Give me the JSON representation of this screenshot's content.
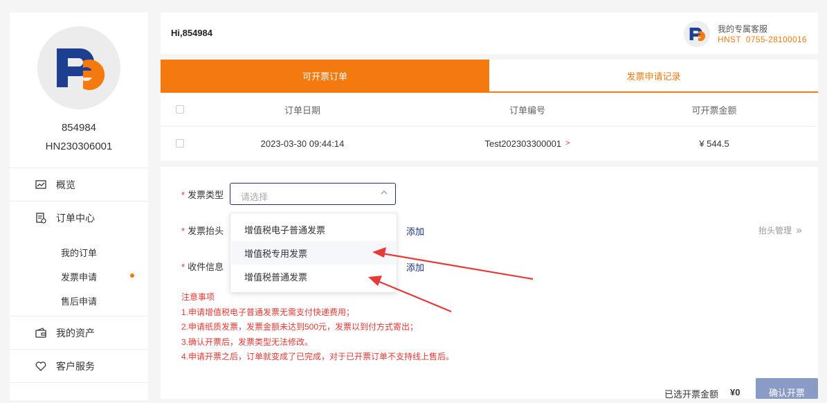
{
  "user": {
    "name": "854984",
    "id": "HN230306001"
  },
  "nav": {
    "items": [
      {
        "label": "概览",
        "icon": "chart-icon"
      },
      {
        "label": "订单中心",
        "icon": "document-icon"
      },
      {
        "label": "我的资产",
        "icon": "wallet-icon"
      },
      {
        "label": "客户服务",
        "icon": "heart-icon"
      }
    ],
    "sub_items": [
      "我的订单",
      "发票申请",
      "售后申请"
    ]
  },
  "header": {
    "greeting": "Hi,854984",
    "service_title": "我的专属客服",
    "service_phone": "HNST  0755-28100016"
  },
  "tabs": [
    "可开票订单",
    "发票申请记录"
  ],
  "table": {
    "headers": [
      "订单日期",
      "订单编号",
      "可开票金额"
    ],
    "rows": [
      {
        "date": "2023-03-30 09:44:14",
        "order_no": "Test202303300001",
        "order_arrow": ">",
        "amount": "¥ 544.5"
      }
    ]
  },
  "form": {
    "invoice_type_label": "发票类型",
    "invoice_type_placeholder": "请选择",
    "invoice_header_label": "发票抬头",
    "add_label": "添加",
    "header_mgmt_label": "抬头管理",
    "recipient_label": "收件信息",
    "dropdown_options": [
      "增值税电子普通发票",
      "增值税专用发票",
      "增值税普通发票"
    ],
    "notes_title": "注意事项",
    "notes": [
      "1.申请增值税电子普通发票无需支付快递费用；",
      "2.申请纸质发票，发票金额未达到500元，发票以到付方式寄出；",
      "3.确认开票后，发票类型无法修改。",
      "4.申请开票之后，订单就变成了已完成，对于已开票订单不支持线上售后。"
    ]
  },
  "footer": {
    "selected_label": "已选开票金额",
    "selected_amount": "¥0",
    "confirm_label": "确认开票"
  },
  "colors": {
    "accent": "#f47a10",
    "brand_blue": "#1a2f7a",
    "alert_red": "#e53935"
  }
}
